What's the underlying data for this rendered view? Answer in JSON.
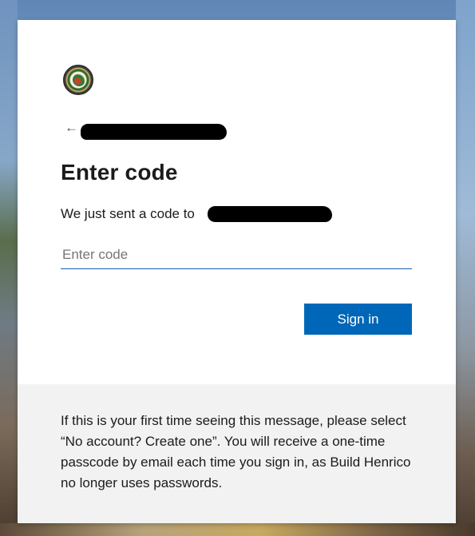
{
  "signin": {
    "title": "Enter code",
    "subtext": "We just sent a code to",
    "code_input": {
      "placeholder": "Enter code",
      "value": ""
    },
    "back_icon": "back-arrow-icon",
    "sign_in_label": "Sign in",
    "accent_color": "#0067b8"
  },
  "notice": {
    "text": "If this is your first time seeing this message, please select “No account? Create one”. You will receive a one-time passcode by email each time you sign in, as Build Henrico no longer uses passwords."
  }
}
